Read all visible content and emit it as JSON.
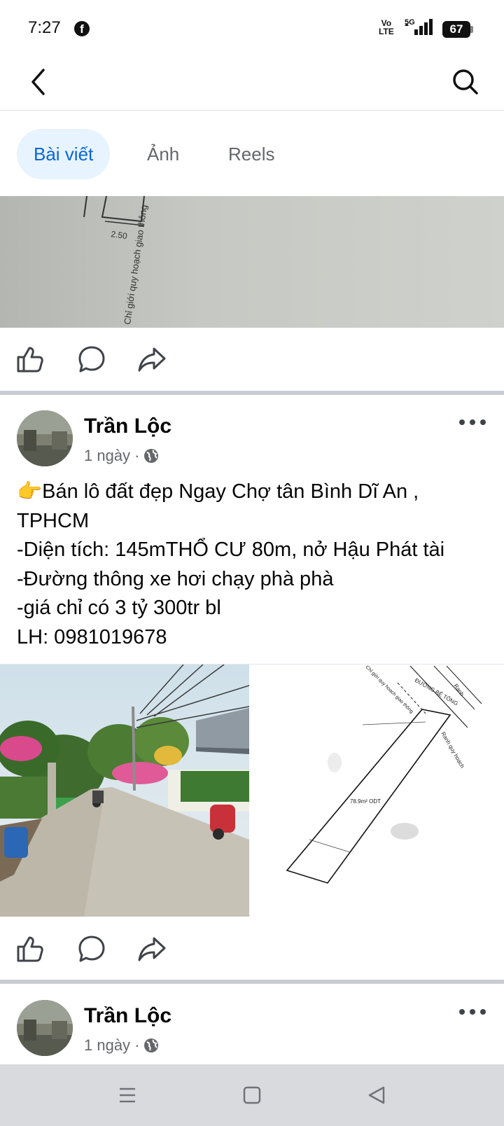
{
  "status_bar": {
    "time": "7:27",
    "network_top": "Vo",
    "network_bottom": "LTE",
    "signal_label": "5G",
    "battery": "67"
  },
  "tabs": [
    {
      "label": "Bài viết",
      "active": true
    },
    {
      "label": "Ảnh",
      "active": false
    },
    {
      "label": "Reels",
      "active": false
    }
  ],
  "previous_post": {
    "plan_dimension": "2.50",
    "plan_caption": "Chỉ giới quy hoạch giao thông"
  },
  "post": {
    "author": "Trần Lộc",
    "time": "1 ngày",
    "separator": "·",
    "lines": [
      "👉Bán lô đất đẹp Ngay Chợ tân Bình Dĩ An ,",
      "TPHCM",
      "-Diện tích: 145mTHỔ CƯ 80m, nở Hậu Phát tài",
      "-Đường thông xe hơi chạy phà phà",
      "-giá chỉ có 3 tỷ 300tr bl",
      "LH: 0981019678"
    ],
    "plan_labels": {
      "road": "ĐƯỜNG BÊ TÔNG",
      "planning_line": "Chỉ giới quy hoạch giao thông",
      "area": "78.9m² ODT",
      "right_label": "Ranh quy hoạch",
      "corner_label": "Ranh"
    }
  },
  "next_post": {
    "author": "Trần Lộc",
    "time": "1 ngày",
    "separator": "·"
  },
  "colors": {
    "accent": "#0866d8",
    "tab_active_bg": "#e7f3ff",
    "text_secondary": "#65676b",
    "divider": "#c9ccd1"
  },
  "icons": [
    "back-arrow-icon",
    "search-icon",
    "like-icon",
    "comment-icon",
    "share-icon",
    "more-icon",
    "globe-icon",
    "menu-icon",
    "home-icon",
    "back-triangle-icon"
  ]
}
